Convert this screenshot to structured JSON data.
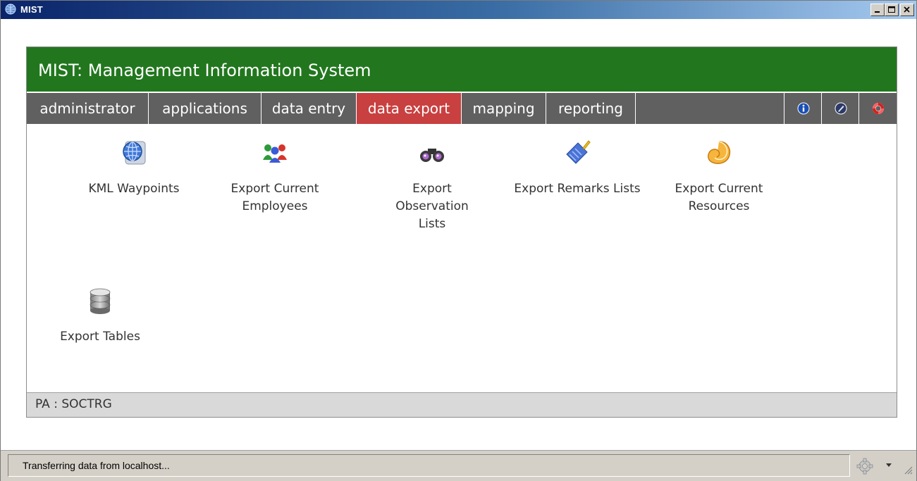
{
  "window": {
    "title": "MIST"
  },
  "app": {
    "heading": "MIST: Management Information System"
  },
  "nav": {
    "items": [
      {
        "label": "administrator"
      },
      {
        "label": "applications"
      },
      {
        "label": "data entry"
      },
      {
        "label": "data export",
        "active": true
      },
      {
        "label": "mapping"
      },
      {
        "label": "reporting"
      }
    ],
    "right_icons": [
      "info-icon",
      "edit-icon",
      "help-lifebuoy-icon"
    ]
  },
  "tiles": [
    {
      "label": "KML Waypoints",
      "icon": "globe-icon"
    },
    {
      "label": "Export Current Employees",
      "icon": "people-icon"
    },
    {
      "label": "Export Observation Lists",
      "icon": "binoculars-icon"
    },
    {
      "label": "Export Remarks Lists",
      "icon": "brush-icon"
    },
    {
      "label": "Export Current Resources",
      "icon": "shell-icon"
    },
    {
      "label": "Export Tables",
      "icon": "database-icon"
    }
  ],
  "footer": {
    "text": "PA : SOCTRG"
  },
  "status": {
    "text": "Transferring data from localhost..."
  },
  "colors": {
    "header_green": "#22771e",
    "nav_gray": "#606060",
    "nav_active": "#c94040"
  }
}
